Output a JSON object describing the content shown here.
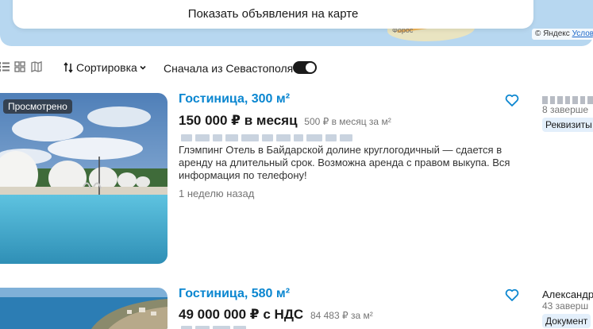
{
  "map": {
    "show_on_map_label": "Показать объявления на карте",
    "town_label": "Форос",
    "copyright": "© Яндекс",
    "terms": "Услов"
  },
  "toolbar": {
    "view_icons": [
      "list-view-icon",
      "grid-view-icon",
      "map-view-icon"
    ],
    "sort_label": "Сортировка",
    "toggle_label": "Сначала из Севастополя",
    "toggle_on": true
  },
  "listings": [
    {
      "badge": "Просмотрено",
      "title": "Гостиница, 300 м²",
      "price": "150 000 ₽ в месяц",
      "price_per_meter": "500 ₽ в месяц за м²",
      "description": "Глэмпинг Отель в Байдарской долине круглогодичный — сдается в аренду на длительный срок. Возможна аренда с правом выкупа. Вся информация по телефону!",
      "posted": "1 неделю назад",
      "seller_meta": "8 заверше",
      "seller_pill": "Реквизиты"
    },
    {
      "title": "Гостиница, 580 м²",
      "price": "49 000 000 ₽ с НДС",
      "price_per_meter": "84 483 ₽ за м²",
      "seller_name": "Александр",
      "seller_meta": "43 заверш",
      "seller_pill": "Документ"
    }
  ],
  "colors": {
    "link_blue": "#0a86d0",
    "map_water": "#b7d7f0",
    "toggle_on": "#1a1a1a"
  }
}
